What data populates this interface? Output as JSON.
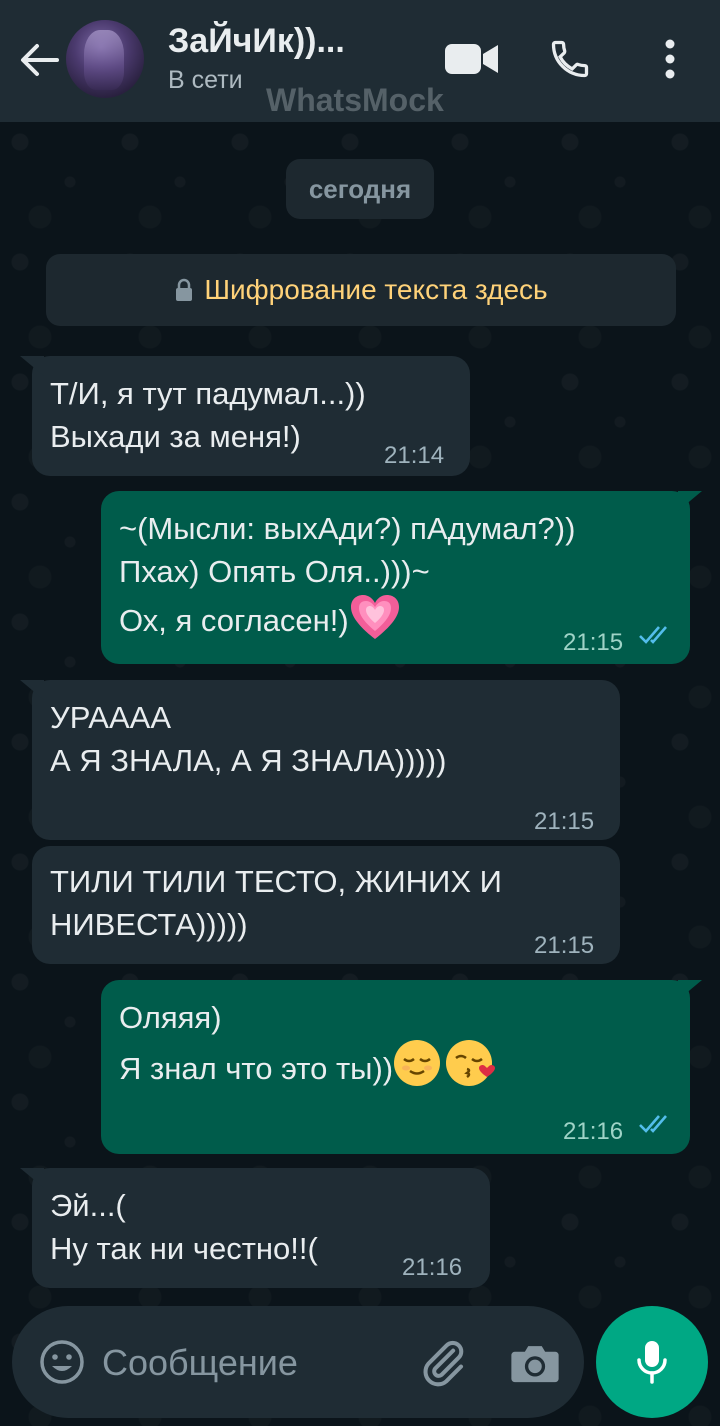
{
  "header": {
    "contact_name": "ЗаЙчИк))...",
    "status": "В сети",
    "watermark": "WhatsMock",
    "icons": [
      "back-arrow-icon",
      "avatar",
      "video-camera-icon",
      "phone-icon",
      "more-vert-icon"
    ]
  },
  "chat": {
    "date_chip": "сегодня",
    "encryption_notice": "Шифрование текста здесь",
    "messages": [
      {
        "direction": "in",
        "lines": [
          "Т/И, я тут падумал...))",
          "Выхади за меня!)"
        ],
        "time": "21:14"
      },
      {
        "direction": "out",
        "lines": [
          "~(Мысли: выхАди?) пАдумал?))",
          "Пхах) Опять Оля..)))~",
          "Ох, я согласен!)"
        ],
        "emoji": [
          "growing-heart-icon"
        ],
        "time": "21:15",
        "status": "read"
      },
      {
        "direction": "in",
        "lines": [
          "УРАААА",
          "А Я ЗНАЛА, А Я ЗНАЛА)))))"
        ],
        "time": "21:15"
      },
      {
        "direction": "in",
        "lines": [
          "ТИЛИ ТИЛИ ТЕСТО, ЖИНИХ И",
          "НИВЕСТА)))))"
        ],
        "time": "21:15"
      },
      {
        "direction": "out",
        "lines": [
          "Оляяя)",
          "Я знал что это ты))"
        ],
        "emoji": [
          "relieved-face-icon",
          "face-blowing-kiss-icon"
        ],
        "time": "21:16",
        "status": "read"
      },
      {
        "direction": "in",
        "lines": [
          "Эй...(",
          "Ну так ни честно!!("
        ],
        "time": "21:16"
      }
    ]
  },
  "composer": {
    "placeholder": "Сообщение",
    "value": ""
  },
  "colors": {
    "header_bg": "#1f2c34",
    "incoming_bubble": "#1f2c34",
    "outgoing_bubble": "#005c4b",
    "read_ticks": "#53bdeb",
    "mic_button": "#00a884",
    "encryption_text": "#ffd279"
  }
}
